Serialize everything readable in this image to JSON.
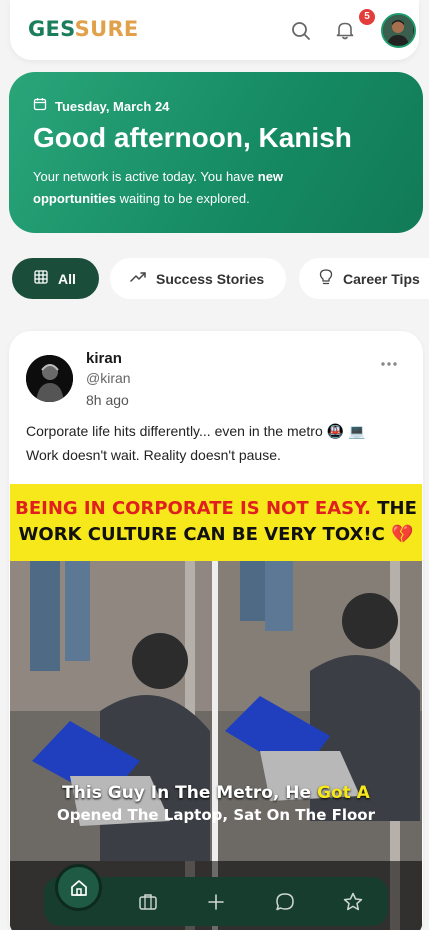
{
  "header": {
    "logo_part1": "GES",
    "logo_part2": "SURE",
    "notification_count": "5",
    "icons": [
      "search-icon",
      "bell-icon"
    ]
  },
  "greeting": {
    "date": "Tuesday, March 24",
    "title": "Good afternoon, Kanish",
    "message_start": "Your network is active today. You have ",
    "message_bold": "new opportunities",
    "message_end": " waiting to be explored."
  },
  "filters": [
    {
      "label": "All",
      "icon": "grid-icon",
      "active": true
    },
    {
      "label": "Success Stories",
      "icon": "trending-up-icon",
      "active": false
    },
    {
      "label": "Career Tips",
      "icon": "lightbulb-icon",
      "active": false
    }
  ],
  "post": {
    "author_name": "kiran",
    "author_handle": "@kiran",
    "time": "8h ago",
    "text_line1": "Corporate life hits differently... even in the metro 🚇 💻",
    "text_line2": "Work doesn't wait. Reality doesn't pause.",
    "image_banner_red": "BEING IN CORPORATE IS NOT EASY.",
    "image_banner_black1": " THE",
    "image_banner_black2": "WORK CULTURE CAN BE VERY TOX!C 💔",
    "image_caption_white": "This Guy In The Metro, He ",
    "image_caption_yellow": "Got A",
    "image_caption_line2": "Opened The Laptop, Sat On The Floor"
  },
  "bottom_nav": {
    "items": [
      "home-icon",
      "briefcase-icon",
      "plus-icon",
      "chat-icon",
      "star-icon"
    ],
    "active": "home-icon"
  },
  "colors": {
    "brand_green": "#1c7d5c",
    "brand_gold": "#e1a14b",
    "card_green": "#158a63",
    "chip_active": "#1b4d3b",
    "nav_bg": "#173d2f",
    "badge_red": "#e43b3b",
    "banner_yellow": "#f6e81b"
  }
}
